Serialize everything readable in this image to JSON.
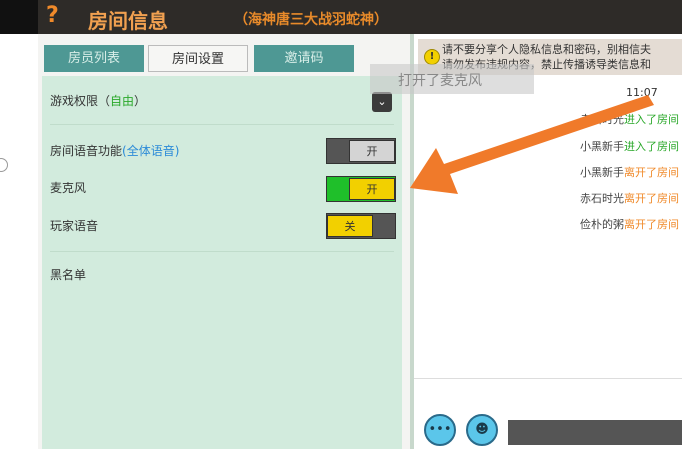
{
  "header": {
    "help_icon": "?",
    "title": "房间信息",
    "subtitle": "（海神唐三大战羽蛇神）"
  },
  "tabs": [
    {
      "label": "房员列表"
    },
    {
      "label": "房间设置"
    },
    {
      "label": "邀请码"
    }
  ],
  "settings": {
    "game_permission": {
      "label": "游戏权限（",
      "value": "自由",
      "close": "）"
    },
    "room_voice": {
      "label": "房间语音功能",
      "value": "(全体语音)",
      "toggle": "开"
    },
    "microphone": {
      "label": "麦克风",
      "toggle": "开"
    },
    "player_voice": {
      "label": "玩家语音",
      "toggle": "关"
    },
    "blacklist": {
      "label": "黑名单"
    }
  },
  "toast": "打开了麦克风",
  "chat": {
    "notice_line1": "请不要分享个人隐私信息和密码，别相信夫",
    "notice_line2": "请勿发布违规内容，禁止传播诱导类信息和",
    "time": "11:07",
    "messages": [
      {
        "name": "赤石时光",
        "action": "进入了房间",
        "type": "enter"
      },
      {
        "name": "小黑新手",
        "action": "进入了房间",
        "type": "enter"
      },
      {
        "name": "小黑新手",
        "action": "离开了房间",
        "type": "leave"
      },
      {
        "name": "赤石时光",
        "action": "离开了房间",
        "type": "leave"
      },
      {
        "name": "俭朴的粥",
        "action": "离开了房间",
        "type": "leave"
      }
    ]
  },
  "colors": {
    "accent": "#f08a2a",
    "tab": "#4e9894",
    "panel": "#d2ebdd",
    "toggle_on": "#f2d000",
    "mic_on": "#1fbf2a"
  }
}
